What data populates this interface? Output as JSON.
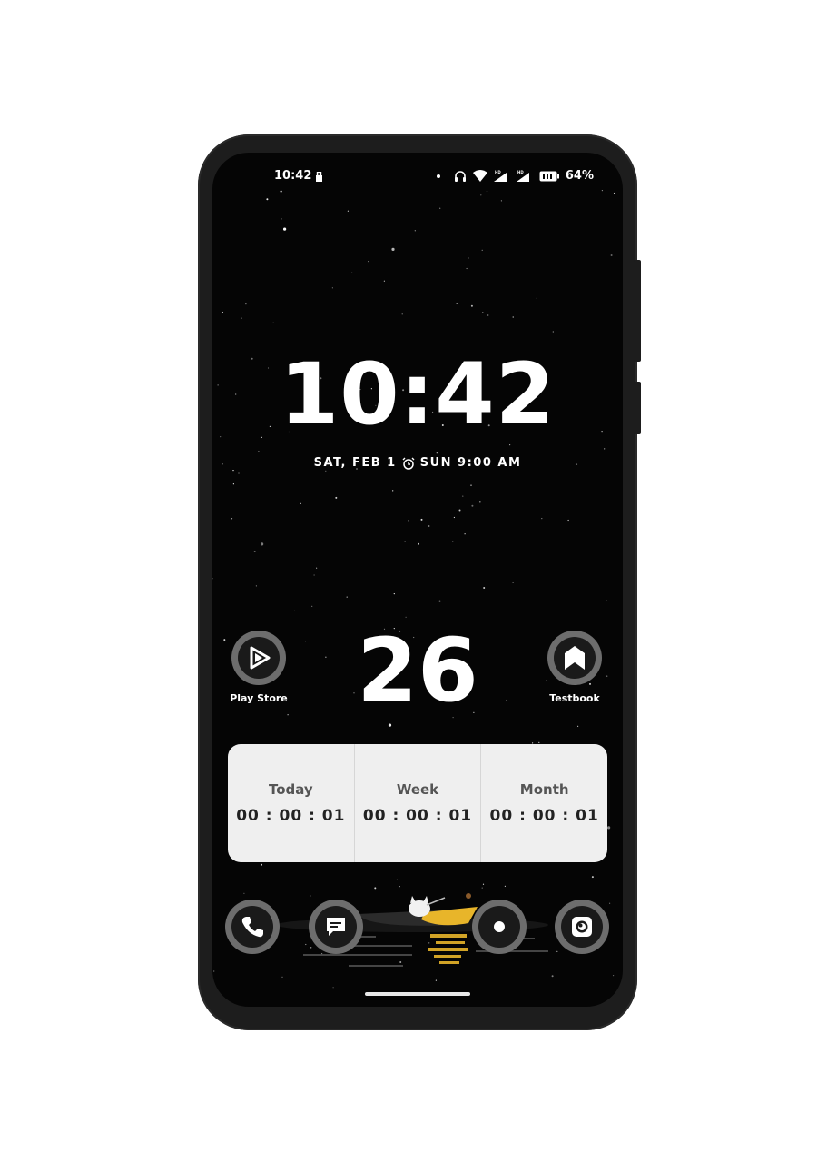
{
  "status_bar": {
    "time": "10:42",
    "battery_percent": "64%",
    "icons": [
      "lock-icon",
      "dot-indicator",
      "headphones-icon",
      "wifi-icon",
      "signal-hd-icon",
      "signal-hd-icon",
      "battery-icon"
    ]
  },
  "lockscreen_clock": {
    "time": "10:42",
    "date": "SAT, FEB 1",
    "alarm_icon": "alarm-clock-icon",
    "alarm": "SUN 9:00 AM"
  },
  "day_widget": {
    "number": "26"
  },
  "shortcuts": [
    {
      "label": "Play Store",
      "icon": "play-store-icon"
    },
    {
      "label": "Testbook",
      "icon": "testbook-icon"
    }
  ],
  "timer_widget": {
    "columns": [
      {
        "label": "Today",
        "value": "00 : 00 : 01"
      },
      {
        "label": "Week",
        "value": "00 : 00 : 01"
      },
      {
        "label": "Month",
        "value": "00 : 00 : 01"
      }
    ]
  },
  "dock": [
    {
      "icon": "phone-icon"
    },
    {
      "icon": "messages-icon"
    },
    {
      "icon": "camera-dot-icon"
    },
    {
      "icon": "camera-icon"
    }
  ],
  "colors": {
    "screen_bg": "#050505",
    "icon_ring": "#6d6d6d",
    "widget_bg": "#efefef",
    "boat_yellow": "#e8b52a"
  }
}
